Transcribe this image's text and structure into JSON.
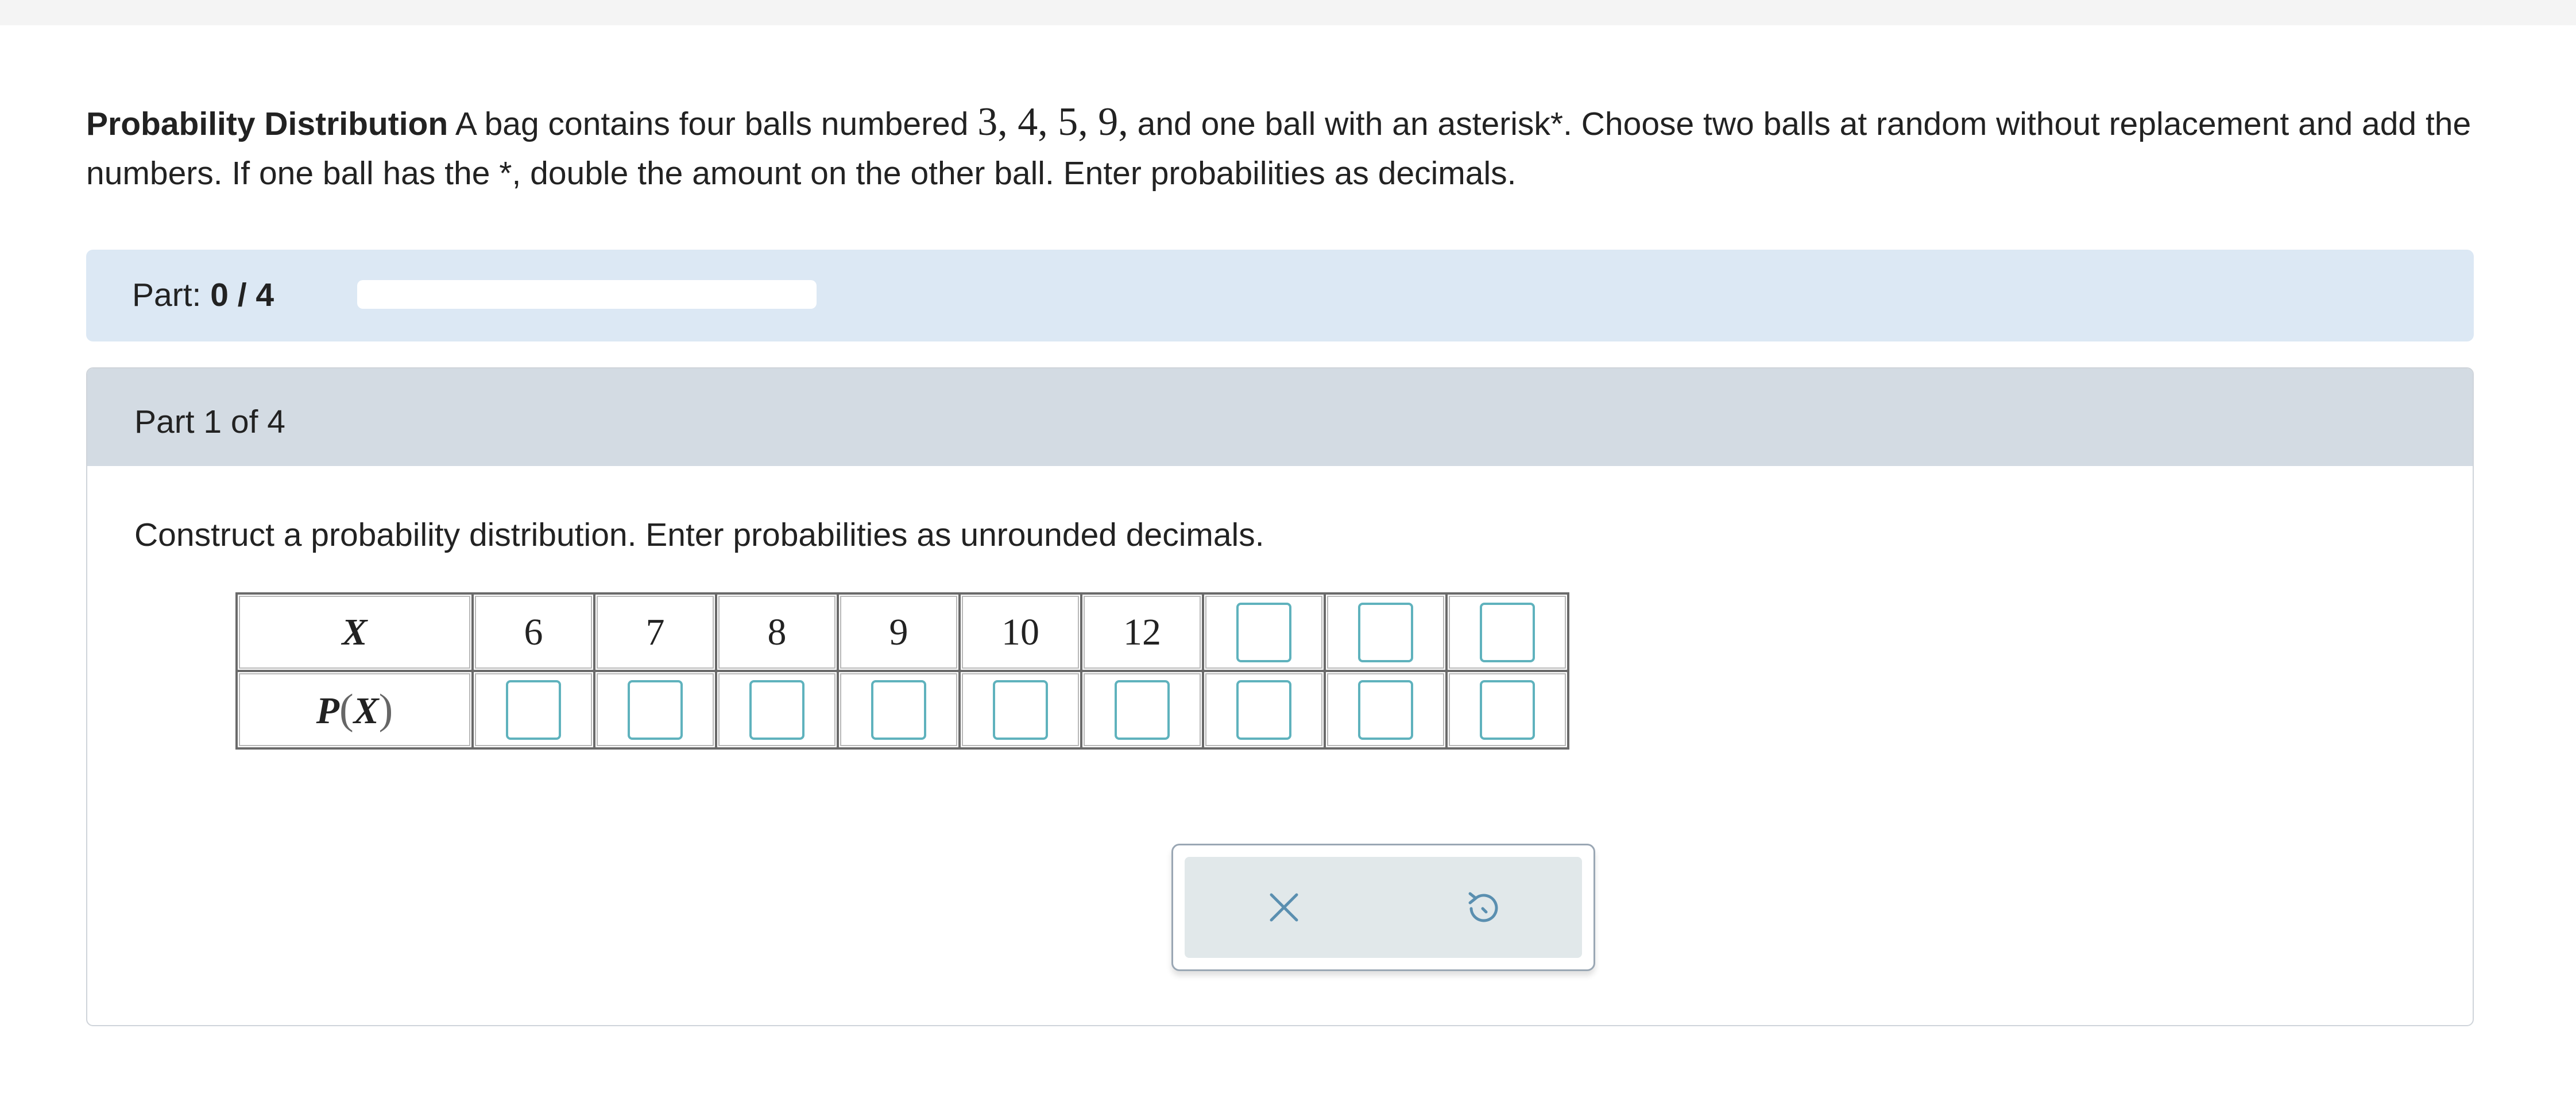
{
  "problem": {
    "title": "Probability Distribution",
    "text_1": " A bag contains four balls numbered ",
    "numbers": "3, 4, 5, 9,",
    "text_2": " and one ball with an asterisk*. Choose two balls at random without replacement and add the numbers. If one ball has the *, double the amount on the other ball. Enter probabilities as decimals."
  },
  "progress": {
    "label": "Part: ",
    "value_text": "0 / 4",
    "fraction": 0
  },
  "part": {
    "header": "Part 1 of 4",
    "instruction": "Construct a probability distribution. Enter probabilities as unrounded decimals."
  },
  "table": {
    "x_label": "X",
    "p_label_p": "P",
    "p_label_open": "(",
    "p_label_x": "X",
    "p_label_close": ")",
    "x_values": [
      "6",
      "7",
      "8",
      "9",
      "10",
      "12"
    ],
    "blank_x_count": 3,
    "p_blank_count": 9
  },
  "actions": {
    "clear_icon": "close-icon",
    "undo_icon": "undo-icon"
  },
  "colors": {
    "accent_panel": "#dce8f4",
    "part_header": "#d3dbe3",
    "input_border": "#5fb2bd",
    "action_icon": "#5a8fb0"
  }
}
